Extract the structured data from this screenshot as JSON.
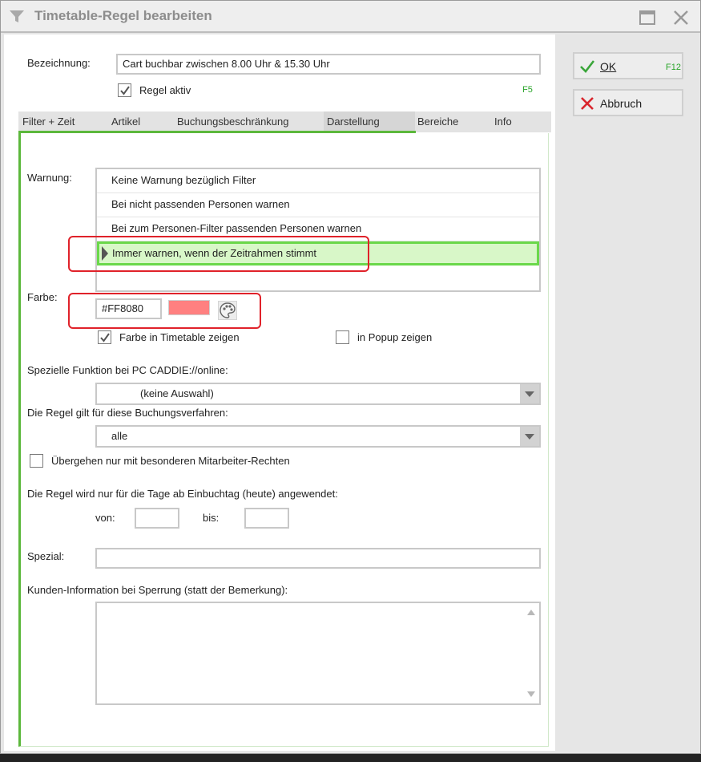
{
  "window": {
    "title": "Timetable-Regel bearbeiten"
  },
  "header": {
    "name_label": "Bezeichnung:",
    "name_value": "Cart buchbar zwischen 8.00 Uhr & 15.30 Uhr",
    "active_label": "Regel aktiv",
    "active_checked": true,
    "active_hotkey": "F5"
  },
  "tabs": [
    {
      "label": "Filter + Zeit"
    },
    {
      "label": "Artikel"
    },
    {
      "label": "Buchungsbeschränkung"
    },
    {
      "label": "Darstellung",
      "active": true
    },
    {
      "label": "Bereiche"
    },
    {
      "label": "Info"
    }
  ],
  "warning": {
    "label": "Warnung:",
    "options": [
      "Keine Warnung bezüglich Filter",
      "Bei nicht passenden Personen warnen",
      "Bei zum Personen-Filter passenden Personen warnen",
      "Immer warnen, wenn der Zeitrahmen stimmt"
    ],
    "selected_index": 3
  },
  "color": {
    "label": "Farbe:",
    "value": "#FF8080",
    "swatch": "#FF8080",
    "palette_icon": "palette-icon",
    "show_in_timetable_label": "Farbe in Timetable zeigen",
    "show_in_timetable_checked": true,
    "show_in_popup_label": "in Popup zeigen",
    "show_in_popup_checked": false
  },
  "online": {
    "label": "Spezielle Funktion bei PC CADDIE://online:",
    "value": "(keine Auswahl)"
  },
  "procedure": {
    "label": "Die Regel gilt für diese Buchungsverfahren:",
    "value": "alle"
  },
  "override": {
    "label": "Übergehen nur mit besonderen Mitarbeiter-Rechten",
    "checked": false
  },
  "days": {
    "label": "Die Regel wird nur für die Tage ab Einbuchtag (heute) angewendet:",
    "from_label": "von:",
    "from_value": "",
    "to_label": "bis:",
    "to_value": ""
  },
  "special": {
    "label": "Spezial:",
    "value": ""
  },
  "customer_info": {
    "label": "Kunden-Information bei Sperrung (statt der Bemerkung):",
    "value": ""
  },
  "buttons": {
    "ok_label": "OK",
    "ok_hotkey": "F12",
    "cancel_label": "Abbruch"
  },
  "colors": {
    "accent_green": "#5cb83c",
    "selection_bg": "#d8f7c8",
    "highlight_red": "#e0222a"
  }
}
